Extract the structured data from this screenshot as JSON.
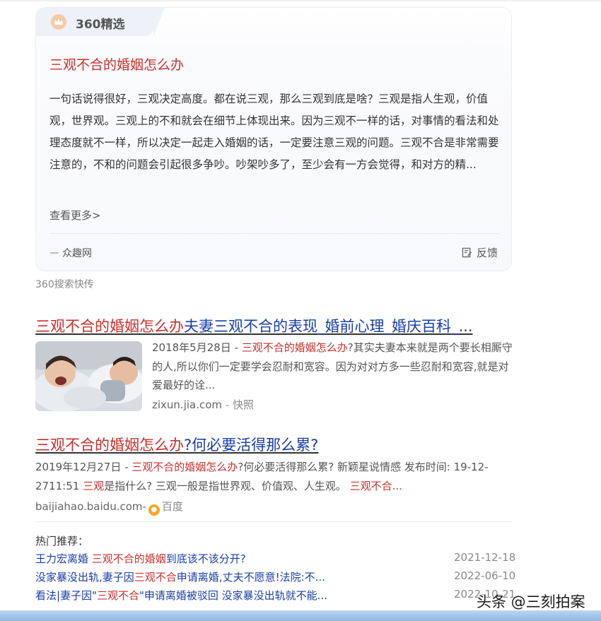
{
  "card": {
    "tag_label": "360精选",
    "title": "三观不合的婚姻怎么办",
    "body": "一句话说得很好，三观决定高度。都在说三观，那么三观到底是啥？三观是指人生观，价值观，世界观。三观上的不和就会在细节上体现出来。因为三观不一样的话，对事情的看法和处理态度就不一样，所以决定一起走入婚姻的话，一定要注意三观的问题。三观不合是非常需要注意的，不和的问题会引起很多争吵。吵架吵多了，至少会有一方会觉得，和对方的精...",
    "more": "查看更多>",
    "source": "众趣网",
    "feedback": "反馈"
  },
  "quick_label": "360搜索快传",
  "results": [
    {
      "title_red": "三观不合的婚姻怎么办",
      "title_blue": "夫妻三观不合的表现_婚前心理_婚庆百科_...",
      "date": "2018年5月28日 - ",
      "hl": "三观不合的婚姻怎么办",
      "rest": "?其实夫妻本来就是两个要长相厮守的人,所以你们一定要学会忍耐和宽容。因为对对方多一些忍耐和宽容,就是对爱最好的诠...",
      "site": "zixun.jia.com",
      "sep": " - ",
      "snap": "快照",
      "thumb_icon": "couple-photo"
    },
    {
      "title_red": "三观不合的婚姻怎么办",
      "title_blue": "?何必要活得那么累?",
      "date": "2019年12月27日 - ",
      "hl": "三观不合的婚姻怎么办",
      "mid1": "?何必要活得那么累? 新颖星说情感 发布时间: 19-12-2711:51 ",
      "hl2": "三观",
      "mid2": "是指什么? 三观一般是指世界观、价值观、人生观。 ",
      "hl3": "三观不合...",
      "site": "baijiahao.baidu.com-",
      "badge": "百度",
      "badge_icon": "baidu-paw-icon"
    }
  ],
  "hot": {
    "heading": "热门推荐：",
    "items": [
      {
        "pre": "王力宏离婚 ",
        "hl": "三观不合的婚姻",
        "post": "到底该不该分开?",
        "date": "2021-12-18"
      },
      {
        "pre": "没家暴没出轨,妻子因",
        "hl": "三观不合",
        "post": "申请离婚,丈夫不愿意!法院:不...",
        "date": "2022-06-10"
      },
      {
        "pre": "看法|妻子因\"",
        "hl": "三观不合",
        "post": "\"申请离婚被驳回 没家暴没出轨就不能...",
        "date": "2022-10-21"
      }
    ]
  },
  "watermark": "头条 @三刻拍案",
  "colors": {
    "highlight": "#c9302c",
    "link": "#1a3ea8",
    "tag_bg": "#eef2f8"
  }
}
